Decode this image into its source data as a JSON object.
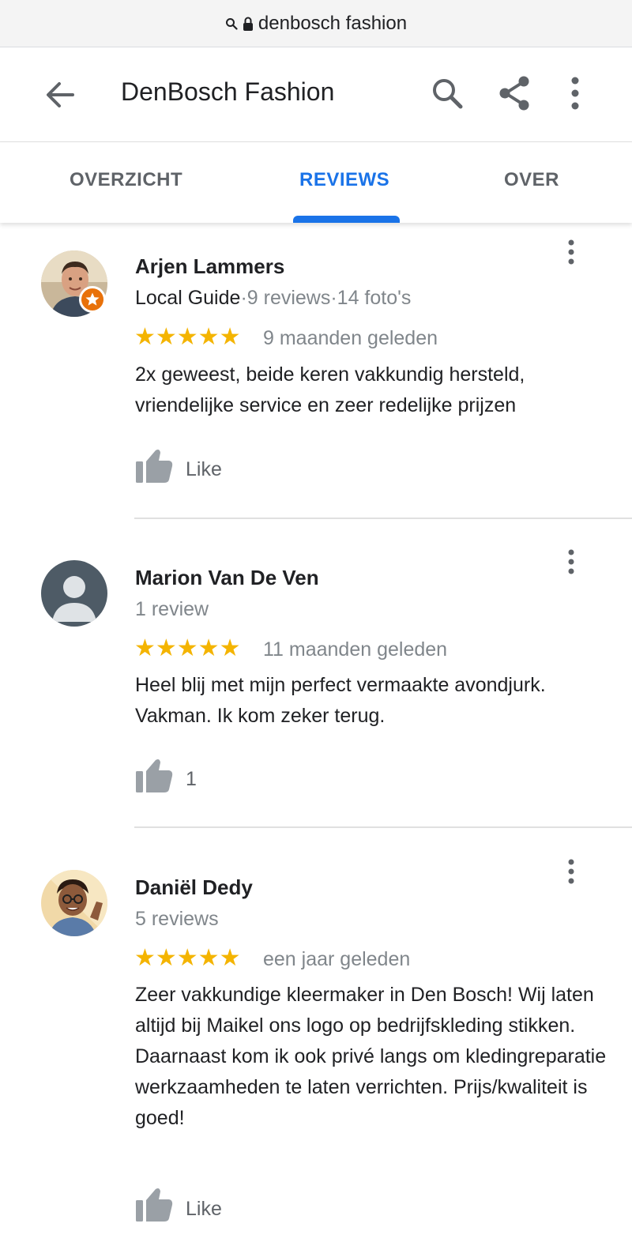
{
  "browser": {
    "url": "denbosch fashion",
    "icons": [
      "search-icon",
      "lock-icon"
    ]
  },
  "appbar": {
    "title": "DenBosch Fashion",
    "icons": [
      "back-arrow-icon",
      "search-icon",
      "share-icon",
      "more-vert-icon"
    ]
  },
  "tabs": [
    {
      "label": "OVERZICHT",
      "active": false
    },
    {
      "label": "REVIEWS",
      "active": true
    },
    {
      "label": "OVER",
      "active": false
    }
  ],
  "colors": {
    "accent": "#1a73e8",
    "star": "#f4b400",
    "badge": "#e8710a",
    "secondary_text": "#80868b"
  },
  "reviews": [
    {
      "name": "Arjen Lammers",
      "badge": "Local Guide",
      "stats": "·9 reviews·14 foto's",
      "rating": 5,
      "stars": "★★★★★",
      "date": "9 maanden geleden",
      "text": "2x geweest, beide keren vakkundig hersteld, vriendelijke service en zeer redelijke prijzen",
      "like_label": "Like"
    },
    {
      "name": "Marion Van De Ven",
      "stats": "1 review",
      "rating": 5,
      "stars": "★★★★★",
      "date": "11 maanden geleden",
      "text": "Heel blij met mijn perfect vermaakte avondjurk. Vakman. Ik kom zeker terug.",
      "like_label": "1"
    },
    {
      "name": "Daniël Dedy",
      "stats": "5 reviews",
      "rating": 5,
      "stars": "★★★★★",
      "date": "een jaar geleden",
      "text": "Zeer vakkundige kleermaker in Den Bosch! Wij laten altijd bij Maikel ons logo op bedrijfskleding stikken. Daarnaast kom ik ook privé langs om kledingreparatie werkzaamheden te laten verrichten. Prijs/kwaliteit is goed!",
      "like_label": "Like"
    }
  ]
}
